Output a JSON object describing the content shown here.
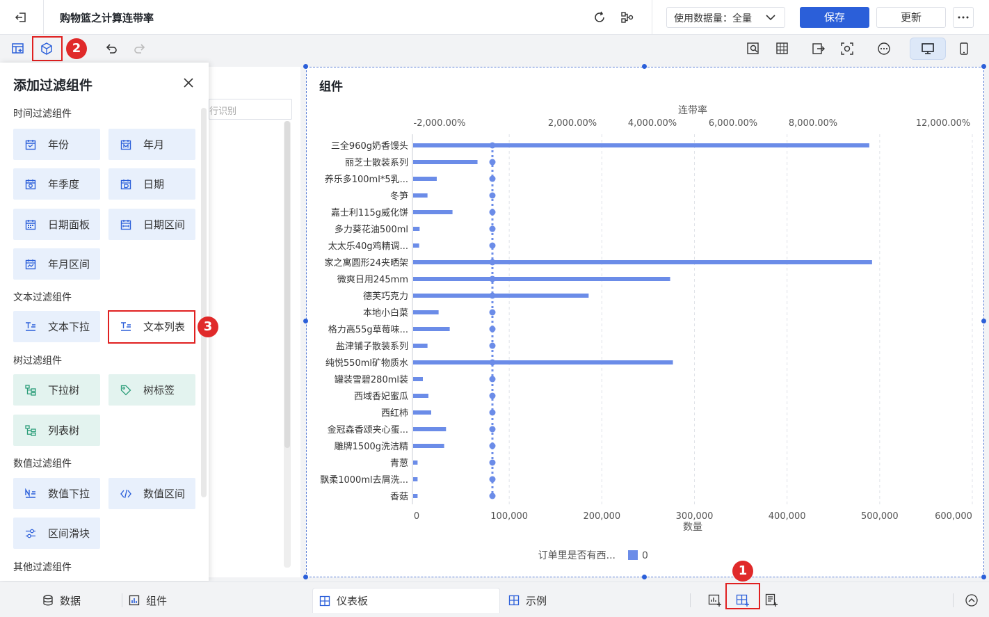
{
  "header": {
    "title": "购物篮之计算连带率",
    "data_select_label": "使用数据量：全量",
    "save_label": "保存",
    "update_label": "更新"
  },
  "canvas": {
    "search_placeholder": "行识别"
  },
  "filter_panel": {
    "title": "添加过滤组件",
    "sections": {
      "time": "时间过滤组件",
      "text": "文本过滤组件",
      "tree": "树过滤组件",
      "number": "数值过滤组件",
      "other": "其他过滤组件"
    },
    "time_items": [
      "年份",
      "年月",
      "年季度",
      "日期",
      "日期面板",
      "日期区间",
      "年月区间"
    ],
    "text_items": [
      "文本下拉",
      "文本列表"
    ],
    "tree_items": [
      "下拉树",
      "树标签",
      "列表树"
    ],
    "number_items": [
      "数值下拉",
      "数值区间",
      "区间滑块"
    ]
  },
  "badges": {
    "b1": "1",
    "b2": "2",
    "b3": "3"
  },
  "widget": {
    "title": "组件"
  },
  "chart_data": {
    "type": "bar",
    "orientation": "horizontal",
    "title": "",
    "categories": [
      "三全960g奶香馒头",
      "丽芝士散装系列",
      "养乐多100ml*5乳...",
      "冬笋",
      "嘉士利115g威化饼",
      "多力葵花油500ml",
      "太太乐40g鸡精调...",
      "家之寓圆形24夹晒架",
      "微爽日用245mm",
      "德芙巧克力",
      "本地小白菜",
      "格力高55g草莓味...",
      "盐津铺子散装系列",
      "纯悦550ml矿物质水",
      "罐装雪碧280ml装",
      "西域香妃蜜瓜",
      "西红柿",
      "金冠森香颂夹心蛋...",
      "雕牌1500g洗洁精",
      "青葱",
      "飘柔1000ml去屑洗...",
      "香菇"
    ],
    "series": [
      {
        "values": [
          488000,
          65000,
          21000,
          11000,
          38000,
          2500,
          2000,
          491000,
          273000,
          185000,
          23000,
          35000,
          11000,
          276000,
          6000,
          12000,
          15000,
          31000,
          29000,
          300,
          300,
          300
        ]
      }
    ],
    "line_series": {
      "values": [
        0.08,
        0.08,
        0.08,
        0.08,
        0.08,
        0.08,
        0.08,
        0.08,
        0.08,
        0.08,
        0.08,
        0.08,
        0.08,
        0.08,
        0.08,
        0.08,
        0.08,
        0.08,
        0.08,
        0.08,
        0.08,
        0.08
      ]
    },
    "xlabel": "数量",
    "x_ticks": [
      "0",
      "100,000",
      "200,000",
      "300,000",
      "400,000",
      "500,000",
      "600,000"
    ],
    "x2label": "连带率",
    "x2_ticks": [
      "-2,000.00%",
      "2,000.00%",
      "4,000.00%",
      "6,000.00%",
      "8,000.00%",
      "12,000.00%"
    ],
    "xlim": [
      0,
      600000
    ],
    "legend": {
      "title": "订单里是否有西...",
      "items": [
        "0"
      ]
    },
    "colors": {
      "bar": "#6b8ce8",
      "line": "#6b8ce8"
    }
  },
  "bottom": {
    "tab_data": "数据",
    "tab_component": "组件",
    "tab_dashboard": "仪表板",
    "tab_example": "示例"
  }
}
